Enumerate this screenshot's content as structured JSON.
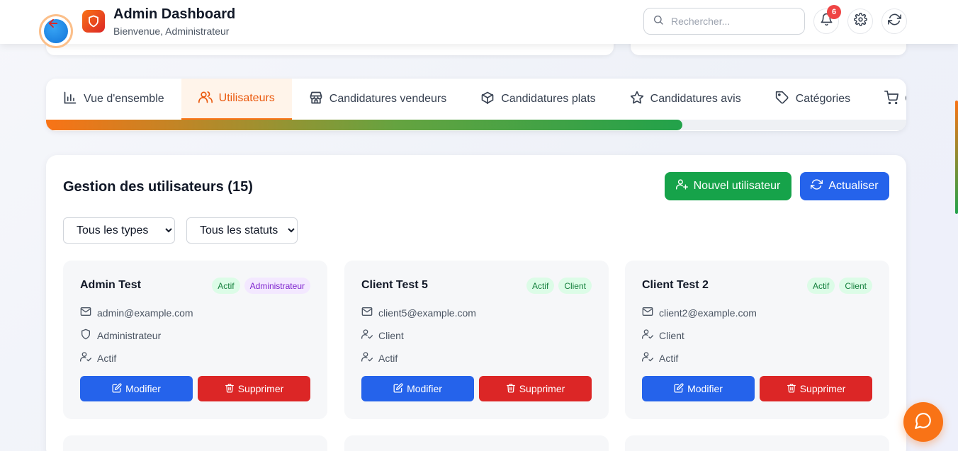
{
  "header": {
    "title": "Admin Dashboard",
    "subtitle": "Bienvenue, Administrateur",
    "search_placeholder": "Rechercher...",
    "notification_count": "6"
  },
  "tabs": [
    {
      "label": "Vue d'ensemble",
      "icon": "bar-chart-icon",
      "active": false
    },
    {
      "label": "Utilisateurs",
      "icon": "users-icon",
      "active": true
    },
    {
      "label": "Candidatures vendeurs",
      "icon": "store-icon",
      "active": false
    },
    {
      "label": "Candidatures plats",
      "icon": "box-icon",
      "active": false
    },
    {
      "label": "Candidatures avis",
      "icon": "star-icon",
      "active": false
    },
    {
      "label": "Catégories",
      "icon": "tag-icon",
      "active": false
    },
    {
      "label": "C",
      "icon": "cart-icon",
      "active": false
    }
  ],
  "progress": {
    "fraction": 0.74
  },
  "main": {
    "title": "Gestion des utilisateurs (15)",
    "new_user_label": "Nouvel utilisateur",
    "refresh_label": "Actualiser",
    "filter_type": {
      "selected": "Tous les types"
    },
    "filter_status": {
      "selected": "Tous les statuts"
    }
  },
  "users": [
    {
      "name": "Admin Test",
      "status_badge": "Actif",
      "role_badge": "Administrateur",
      "role_color": "purple",
      "email": "admin@example.com",
      "role": "Administrateur",
      "role_icon": "shield-icon",
      "status": "Actif",
      "edit_label": "Modifier",
      "delete_label": "Supprimer"
    },
    {
      "name": "Client Test 5",
      "status_badge": "Actif",
      "role_badge": "Client",
      "role_color": "green",
      "email": "client5@example.com",
      "role": "Client",
      "role_icon": "user-check-icon",
      "status": "Actif",
      "edit_label": "Modifier",
      "delete_label": "Supprimer"
    },
    {
      "name": "Client Test 2",
      "status_badge": "Actif",
      "role_badge": "Client",
      "role_color": "green",
      "email": "client2@example.com",
      "role": "Client",
      "role_icon": "user-check-icon",
      "status": "Actif",
      "edit_label": "Modifier",
      "delete_label": "Supprimer"
    }
  ],
  "colors": {
    "accent": "#f97316",
    "primary_blue": "#2563eb",
    "success_green": "#16a34a",
    "danger_red": "#dc2626"
  }
}
